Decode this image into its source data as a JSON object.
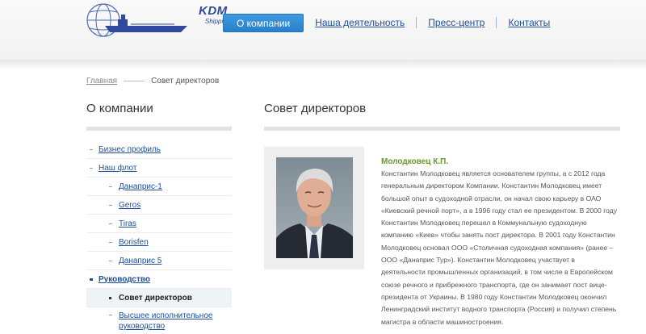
{
  "logo": {
    "title": "KDM",
    "subtitle": "Shipping",
    "brand_color": "#2f4a9c"
  },
  "nav": {
    "active": "О компании",
    "links": [
      "Наша деятельность",
      "Пресс-центр",
      "Контакты"
    ]
  },
  "breadcrumb": {
    "home": "Главная",
    "current": "Совет директоров"
  },
  "sidebar": {
    "title": "О компании",
    "items": [
      {
        "label": "Бизнес профиль"
      },
      {
        "label": "Наш флот"
      },
      {
        "label": "Данаприс-1"
      },
      {
        "label": "Geros"
      },
      {
        "label": "Tiras"
      },
      {
        "label": "Borisfen"
      },
      {
        "label": "Данаприс 5"
      },
      {
        "label": "Руководство"
      },
      {
        "label": "Совет директоров"
      },
      {
        "label": "Высшее исполнительное руководство"
      }
    ]
  },
  "main": {
    "title": "Совет директоров",
    "person": {
      "name": "Молодковец К.П.",
      "bio": "Константин Молодковец является основателем группы, а с 2012 года генеральным директором Компании. Константин Молодковец имеет большой опыт в судоходной отрасли, он начал свою карьеру в ОАО «Киевский речной порт», а в 1996 году стал ее президентом. В 2000 году Константин Молодковец перешел в Коммунальную судоходную компанию «Киев» чтобы занять пост директора. В 2001 году Константин Молодковец основал ООО «Столичная судоходная компания» (ранее – ООО «Данаприс Тур»). Константин Молодковец участвует в деятельности промышленных организаций, в том числе в Европейском союзе речного и прибрежного транспорта, где он занимает пост вице-президента от Украины. В 1980 году Константин Молодковец окончил Ленинградский институт водного транспорта (Россия) и получил степень магистра в области машиностроения."
    }
  }
}
